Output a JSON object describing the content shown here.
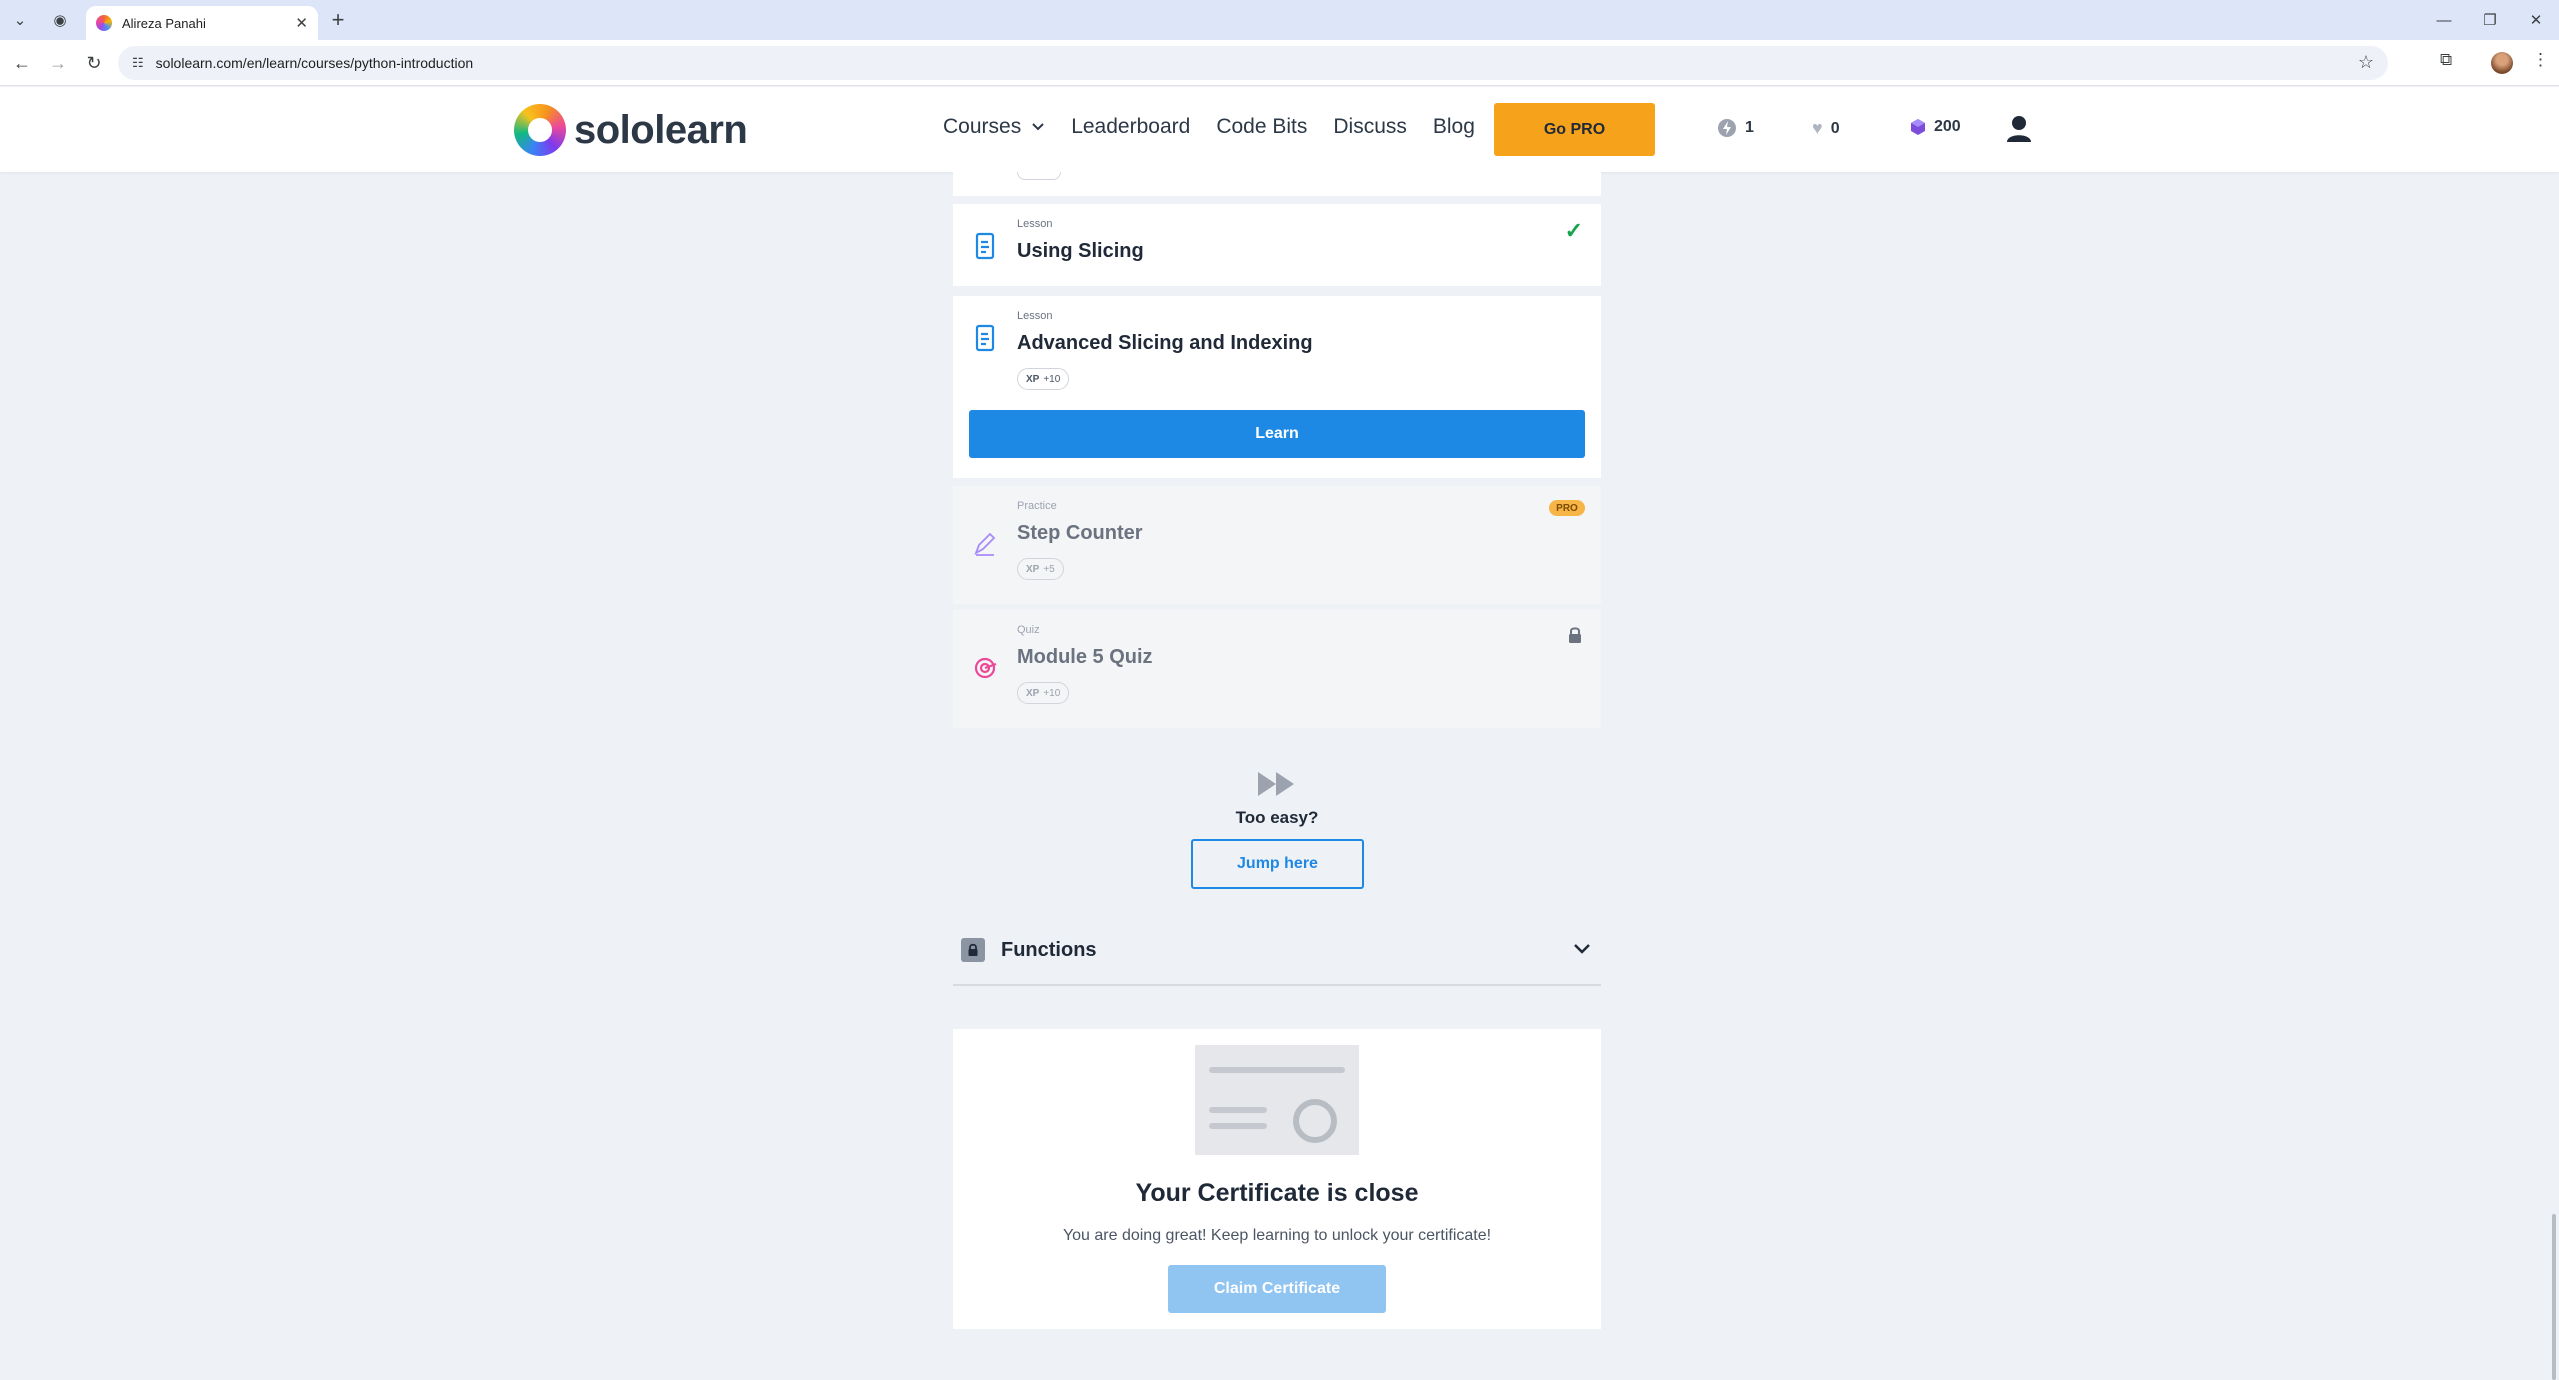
{
  "browser": {
    "tab_title": "Alireza Panahi",
    "url": "sololearn.com/en/learn/courses/python-introduction"
  },
  "header": {
    "logo_text": "sololearn",
    "nav": [
      "Courses",
      "Leaderboard",
      "Code Bits",
      "Discuss",
      "Blog"
    ],
    "go_pro": "Go PRO",
    "stats": {
      "streak": "1",
      "hearts": "0",
      "bits": "200"
    }
  },
  "items": [
    {
      "type": "Lesson",
      "title": "Using Slicing",
      "completed": true
    },
    {
      "type": "Lesson",
      "title": "Advanced Slicing and Indexing",
      "xp_label": "XP",
      "xp_value": "+10",
      "button": "Learn"
    },
    {
      "type": "Practice",
      "title": "Step Counter",
      "xp_label": "XP",
      "xp_value": "+5",
      "badge": "PRO"
    },
    {
      "type": "Quiz",
      "title": "Module 5 Quiz",
      "xp_label": "XP",
      "xp_value": "+10",
      "locked": true
    }
  ],
  "jump": {
    "text": "Too easy?",
    "button": "Jump here"
  },
  "module": {
    "title": "Functions",
    "locked": true
  },
  "certificate": {
    "title": "Your Certificate is close",
    "subtitle": "You are doing great! Keep learning to unlock your certificate!",
    "button": "Claim Certificate"
  },
  "colors": {
    "accent": "#1e88e5",
    "pro": "#f7a21b",
    "success": "#16a34a"
  }
}
